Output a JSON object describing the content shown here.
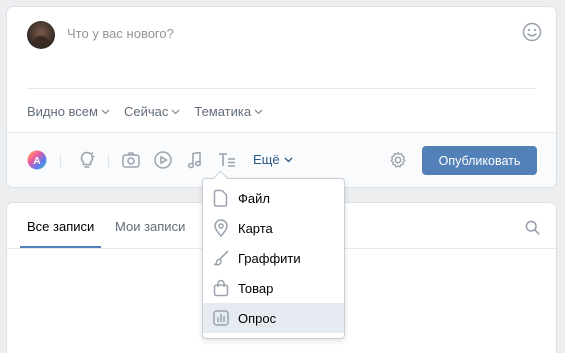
{
  "composer": {
    "placeholder": "Что у вас нового?",
    "visibility": "Видно всем",
    "timing": "Сейчас",
    "topic": "Тематика",
    "more_label": "Ещё",
    "publish_label": "Опубликовать"
  },
  "dropdown": {
    "items": [
      {
        "label": "Файл",
        "icon": "file-icon"
      },
      {
        "label": "Карта",
        "icon": "map-pin-icon"
      },
      {
        "label": "Граффити",
        "icon": "brush-icon"
      },
      {
        "label": "Товар",
        "icon": "bag-icon"
      },
      {
        "label": "Опрос",
        "icon": "poll-icon"
      }
    ],
    "hovered_index": 4
  },
  "feed": {
    "tabs": [
      {
        "label": "Все записи",
        "active": true
      },
      {
        "label": "Мои записи",
        "active": false
      }
    ]
  },
  "colors": {
    "accent": "#5181b8",
    "link": "#2a5885",
    "icon_gray": "#99a2ad",
    "background": "#edeef0"
  }
}
